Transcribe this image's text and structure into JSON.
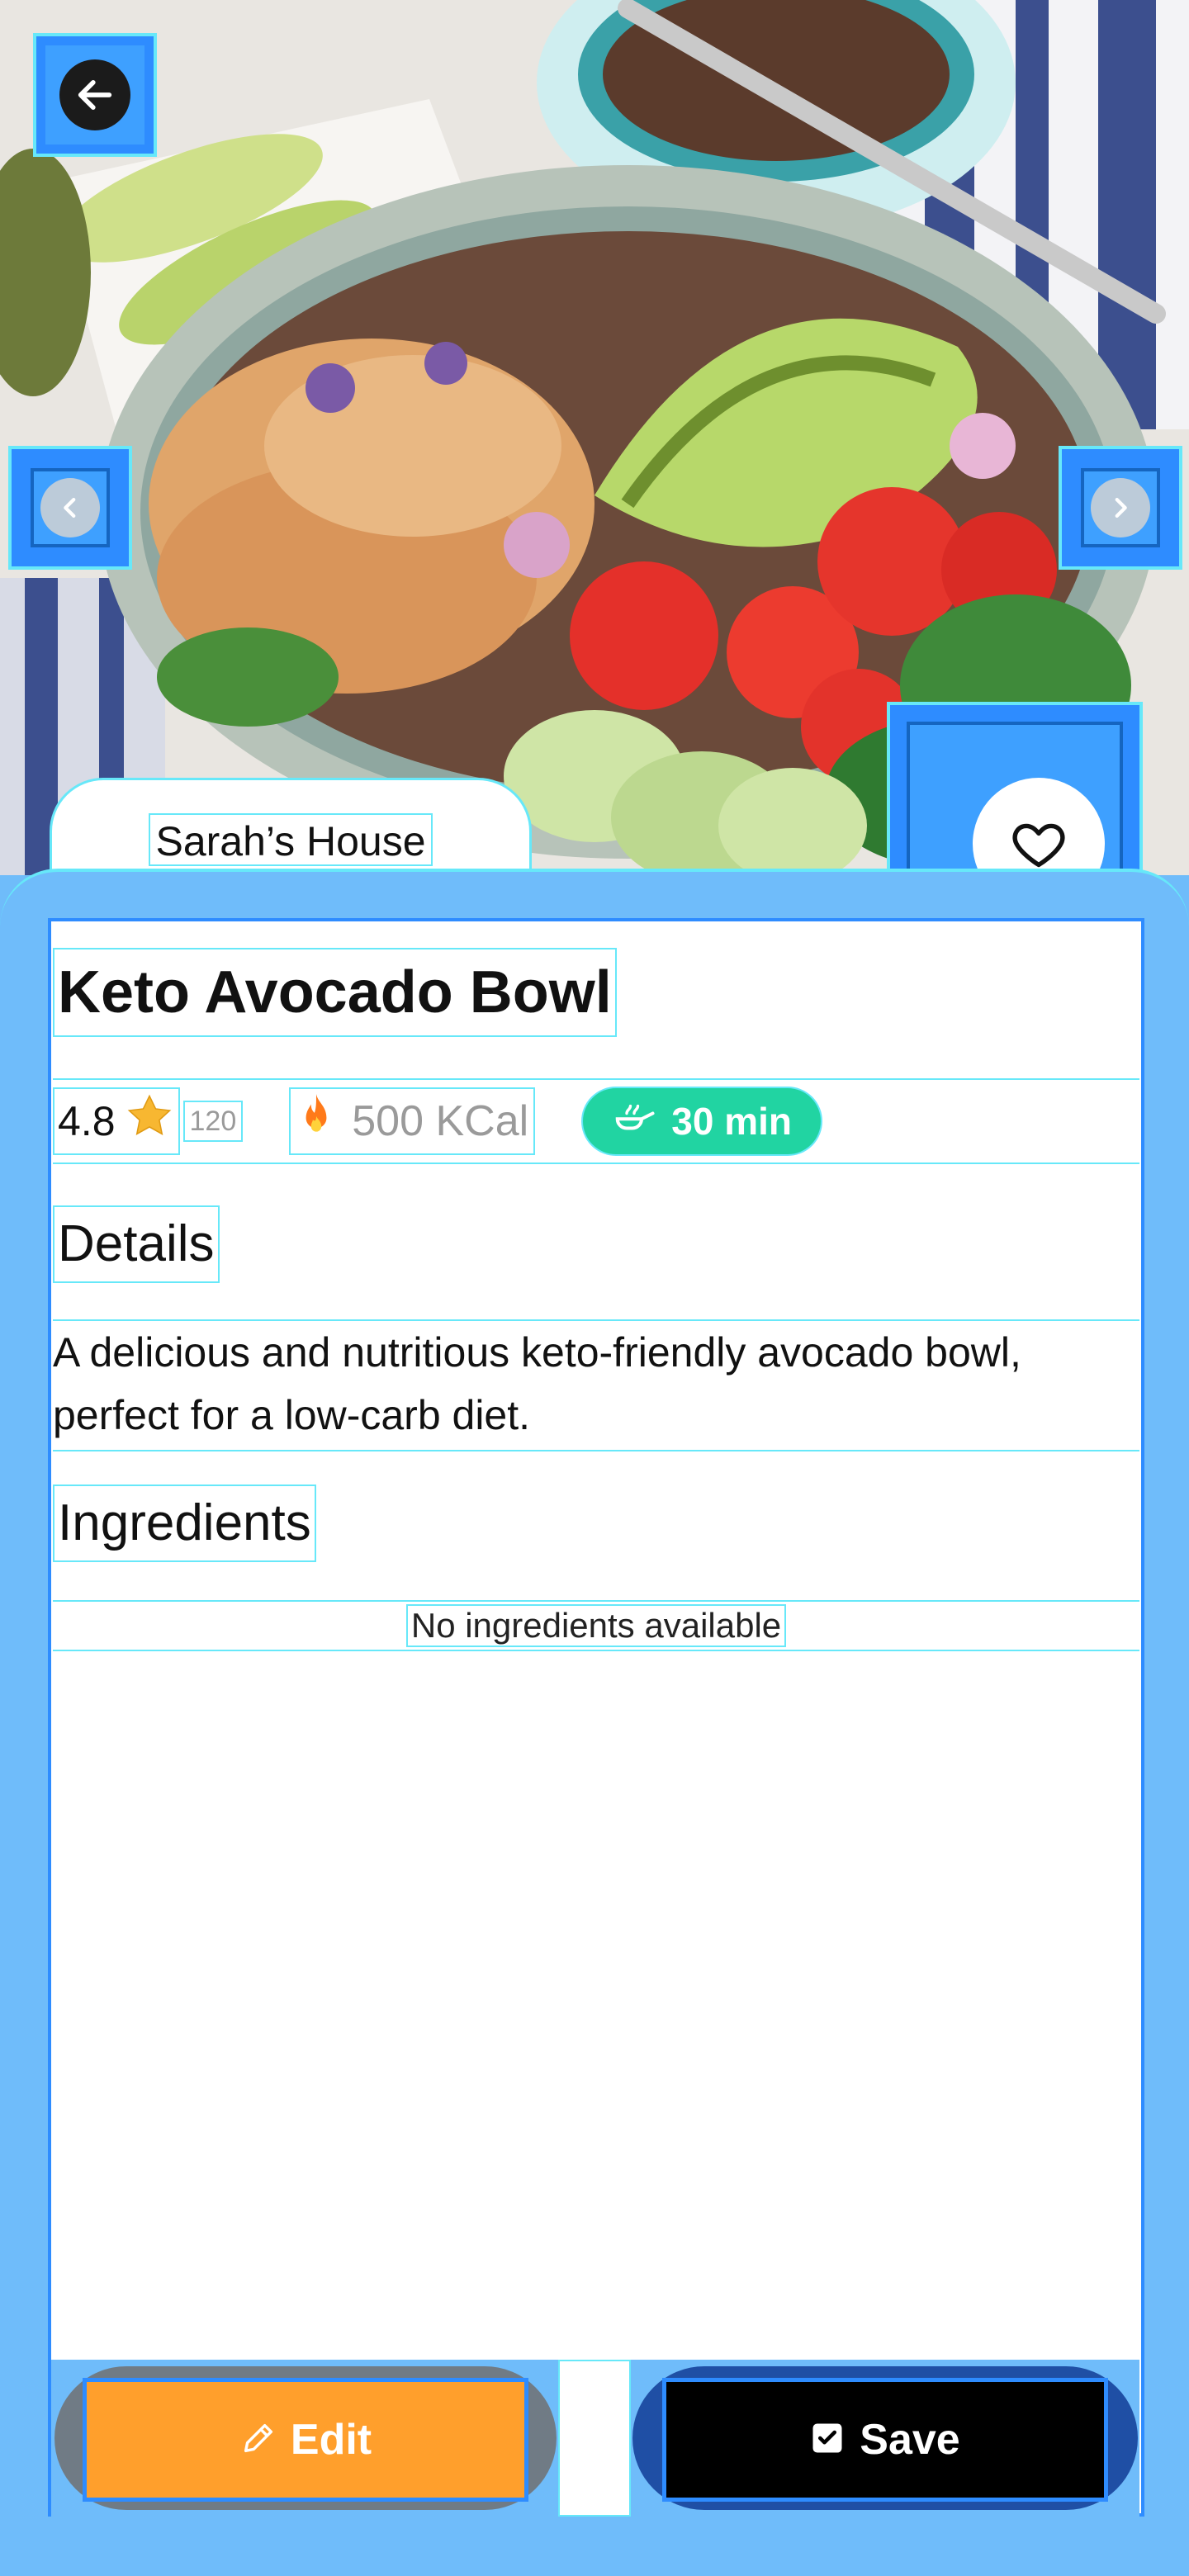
{
  "hero": {
    "owner_label": "Sarah’s House"
  },
  "recipe": {
    "title": "Keto Avocado Bowl",
    "rating": "4.8",
    "review_count": "120",
    "calories": "500 KCal",
    "time": "30 min",
    "details_heading": "Details",
    "description": "A delicious and nutritious keto-friendly avocado bowl, perfect for a low-carb diet.",
    "ingredients_heading": "Ingredients",
    "ingredients_empty": "No ingredients available"
  },
  "actions": {
    "edit_label": "Edit",
    "save_label": "Save"
  },
  "colors": {
    "time_pill": "#21d4a2",
    "edit_button": "#ff9f2c",
    "save_button": "#000000",
    "star": "#f7b731"
  },
  "icons": {
    "back": "arrow-left-icon",
    "prev": "chevron-left-icon",
    "next": "chevron-right-icon",
    "favorite": "heart-outline-icon",
    "rating": "star-icon",
    "calories": "fire-icon",
    "time": "cooking-pan-icon",
    "edit": "pencil-icon",
    "save": "checkmark-icon"
  }
}
